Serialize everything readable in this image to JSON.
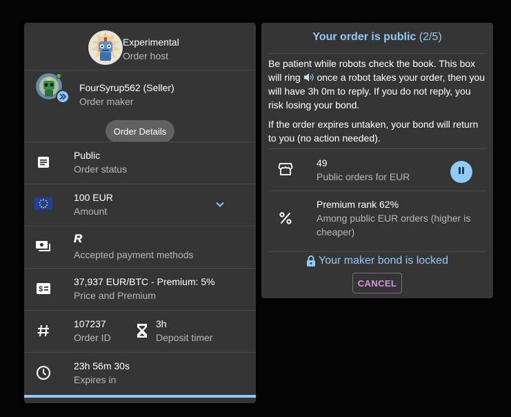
{
  "host": {
    "name": "Experimental",
    "role": "Order host"
  },
  "maker": {
    "name": "FourSyrup562 (Seller)",
    "role": "Order maker"
  },
  "details_chip": "Order Details",
  "status": {
    "value": "Public",
    "label": "Order status"
  },
  "amount": {
    "value": "100 EUR",
    "label": "Amount"
  },
  "payment": {
    "method": "R",
    "label": "Accepted payment methods"
  },
  "price": {
    "value": "37,937 EUR/BTC - Premium: 5%",
    "label": "Price and Premium"
  },
  "order_id": {
    "value": "107237",
    "label": "Order ID"
  },
  "deposit": {
    "value": "3h",
    "label": "Deposit timer"
  },
  "expires": {
    "value": "23h 56m 30s",
    "label": "Expires in"
  },
  "right": {
    "title": "Your order is public",
    "step": "(2/5)",
    "para1_a": "Be patient while robots check the book. This box will ring",
    "para1_b": "once a robot takes your order, then you will have 3h 0m to reply. If you do not reply, you risk losing your bond.",
    "para2": "If the order expires untaken, your bond will return to you (no action needed).",
    "public_count": "49",
    "public_label": "Public orders for EUR",
    "rank": "Premium rank 62%",
    "rank_label": "Among public EUR orders (higher is cheaper)",
    "bond": "Your maker bond is locked",
    "cancel": "CANCEL"
  },
  "icons": {
    "status": "article-icon",
    "amount": "eu-flag-icon",
    "payment": "payments-icon",
    "price": "price-icon",
    "order_id": "hash-icon",
    "deposit": "hourglass-icon",
    "expires": "clock-icon",
    "storefront": "storefront-icon",
    "percent": "percent-icon",
    "pause": "pause-icon",
    "lock": "lock-icon",
    "speaker": "speaker-icon",
    "expand": "chevron-down-icon"
  },
  "colors": {
    "accent": "#90caf9",
    "cancel": "#ce93d8",
    "card": "#353535",
    "background": "#050505",
    "online": "#4caf50"
  }
}
